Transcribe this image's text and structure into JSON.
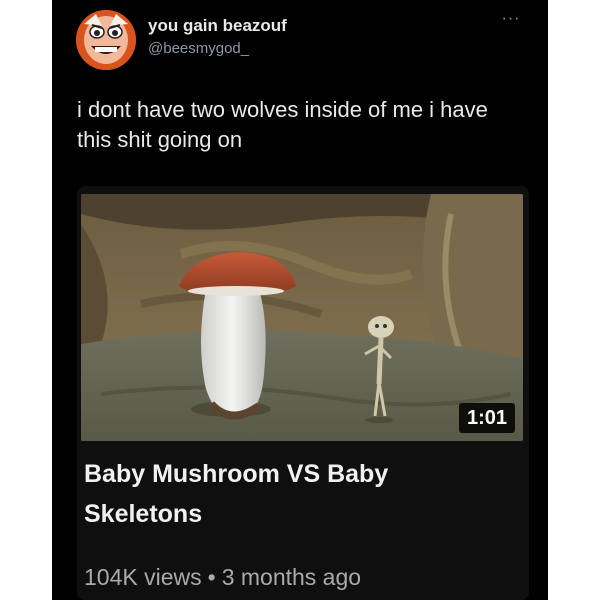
{
  "user": {
    "display_name": "you gain beazouf",
    "handle": "@beesmygod_",
    "avatar_icon": "cartoon-face-avatar"
  },
  "more_icon": "ellipsis-icon",
  "more_glyph": "···",
  "tweet_text": "i dont have two wolves inside of me i have this shit going on",
  "video": {
    "duration": "1:01",
    "title": "Baby Mushroom VS Baby Skeletons",
    "views": "104K views",
    "separator": "•",
    "age": "3 months ago"
  },
  "colors": {
    "background": "#000000",
    "primary_text": "#e7e9ea",
    "secondary_text": "#8b98a5",
    "video_meta": "#aaaaaa"
  }
}
